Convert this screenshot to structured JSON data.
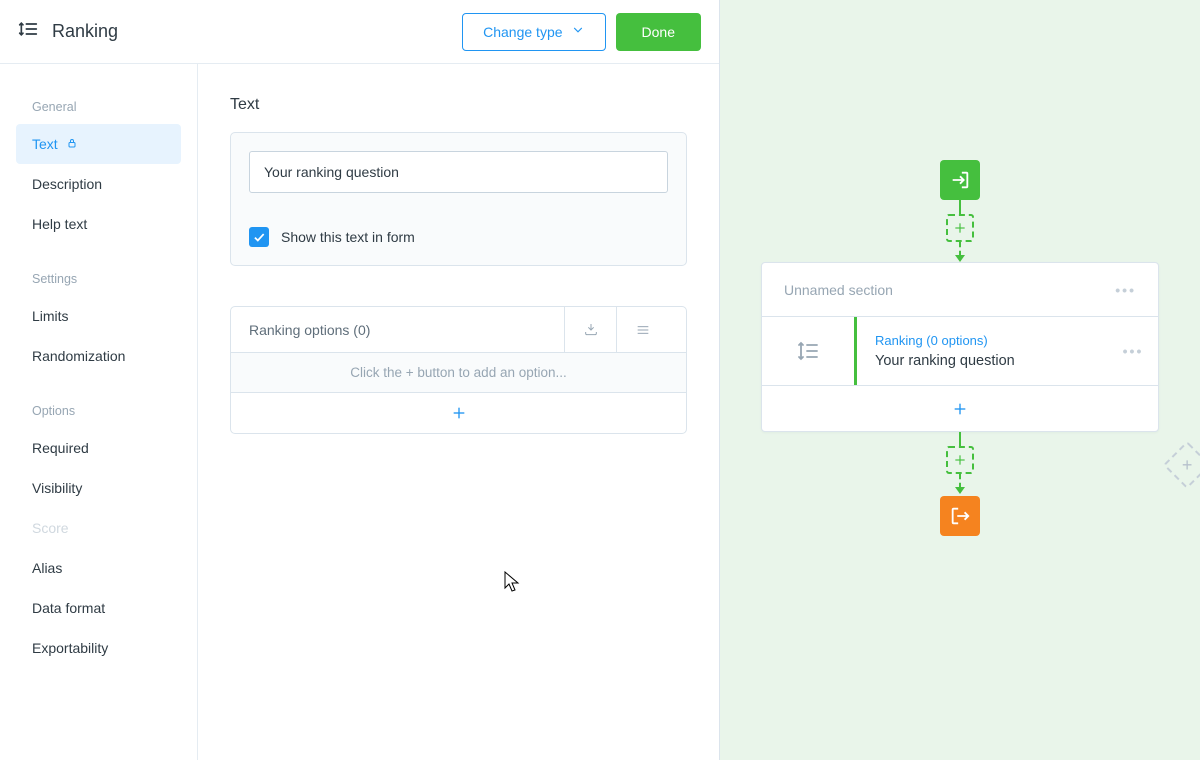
{
  "colors": {
    "blue": "#2095f2",
    "green": "#45bf3e",
    "orange": "#f5831f"
  },
  "header": {
    "title": "Ranking",
    "change_type": "Change type",
    "done": "Done"
  },
  "sidebar": {
    "groups": {
      "general": "General",
      "settings": "Settings",
      "options": "Options"
    },
    "items": {
      "text": "Text",
      "description": "Description",
      "help_text": "Help text",
      "limits": "Limits",
      "randomization": "Randomization",
      "required": "Required",
      "visibility": "Visibility",
      "score": "Score",
      "alias": "Alias",
      "data_format": "Data format",
      "exportability": "Exportability"
    }
  },
  "main": {
    "section_title": "Text",
    "question_value": "Your ranking question",
    "show_in_form": "Show this text in form",
    "options_header": "Ranking options (0)",
    "options_empty": "Click the + button to add an option..."
  },
  "canvas": {
    "section_name": "Unnamed section",
    "question_type": "Ranking (0 options)",
    "question_text": "Your ranking question"
  }
}
